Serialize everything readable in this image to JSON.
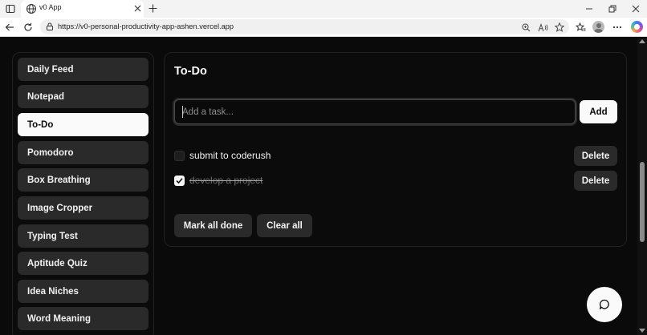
{
  "browser": {
    "tab_title": "v0 App",
    "url": "https://v0-personal-productivity-app-ashen.vercel.app"
  },
  "sidebar": {
    "items": [
      {
        "label": "Daily Feed",
        "active": false
      },
      {
        "label": "Notepad",
        "active": false
      },
      {
        "label": "To-Do",
        "active": true
      },
      {
        "label": "Pomodoro",
        "active": false
      },
      {
        "label": "Box Breathing",
        "active": false
      },
      {
        "label": "Image Cropper",
        "active": false
      },
      {
        "label": "Typing Test",
        "active": false
      },
      {
        "label": "Aptitude Quiz",
        "active": false
      },
      {
        "label": "Idea Niches",
        "active": false
      },
      {
        "label": "Word Meaning",
        "active": false
      }
    ]
  },
  "todo": {
    "title": "To-Do",
    "input_value": "",
    "input_placeholder": "Add a task...",
    "add_label": "Add",
    "tasks": [
      {
        "text": "submit to coderush",
        "done": false
      },
      {
        "text": "develop a project",
        "done": true
      }
    ],
    "delete_label": "Delete",
    "mark_all_label": "Mark all done",
    "clear_all_label": "Clear all"
  },
  "colors": {
    "background": "#0a0a0a",
    "card_border": "#222222",
    "button_dark": "#2a2a2a",
    "active_nav": "#fafafa"
  },
  "icons": {
    "tab": "globe-icon",
    "chat": "chat-bubble-icon"
  }
}
